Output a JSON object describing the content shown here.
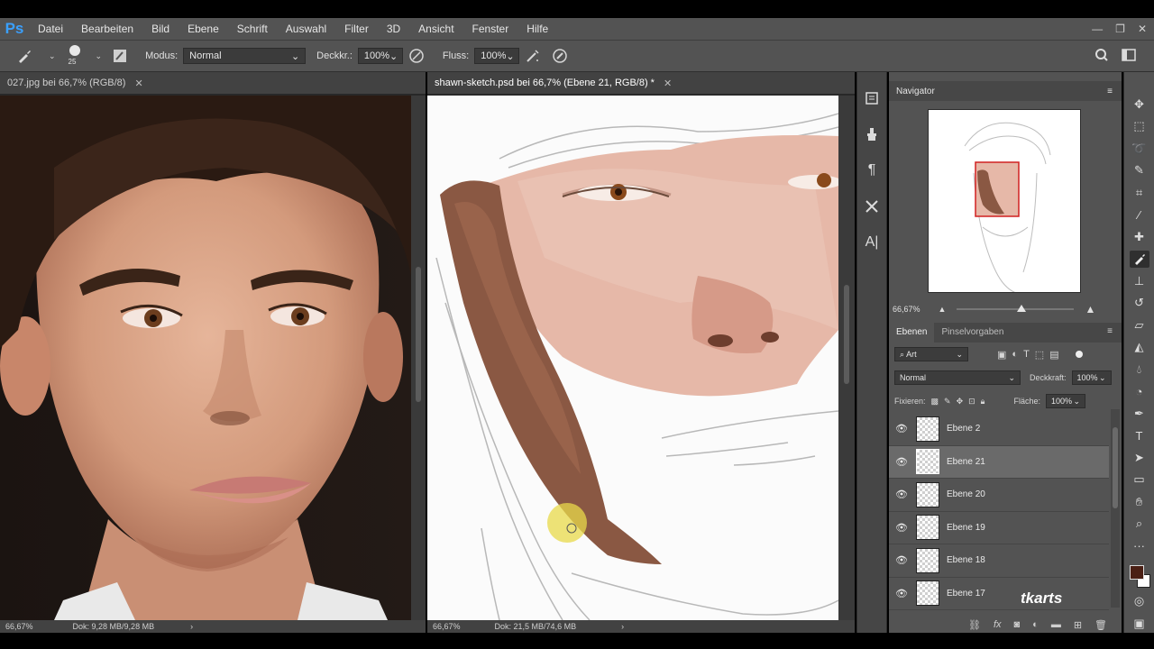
{
  "app": {
    "logo": "Ps",
    "menu": [
      "Datei",
      "Bearbeiten",
      "Bild",
      "Ebene",
      "Schrift",
      "Auswahl",
      "Filter",
      "3D",
      "Ansicht",
      "Fenster",
      "Hilfe"
    ],
    "window_controls": [
      "minimize-icon",
      "restore-icon",
      "close-icon"
    ]
  },
  "options": {
    "brush_size": "25",
    "mode_label": "Modus:",
    "mode_value": "Normal",
    "opacity_label": "Deckkr.:",
    "opacity_value": "100%",
    "flow_label": "Fluss:",
    "flow_value": "100%"
  },
  "doc1": {
    "tab_title": "027.jpg bei 66,7% (RGB/8)",
    "zoom": "66,67%",
    "doc_size": "Dok: 9,28 MB/9,28 MB"
  },
  "doc2": {
    "tab_title": "shawn-sketch.psd bei 66,7% (Ebene 21, RGB/8) *",
    "zoom": "66,67%",
    "doc_size": "Dok: 21,5 MB/74,6 MB"
  },
  "navigator": {
    "title": "Navigator",
    "zoom": "66,67%",
    "zoom_slider_fraction": 0.55
  },
  "layers": {
    "tabs": [
      "Ebenen",
      "Pinselvorgaben"
    ],
    "filter_kind": "Art",
    "blend_mode": "Normal",
    "opacity_label": "Deckkraft:",
    "opacity_value": "100%",
    "lock_label": "Fixieren:",
    "fill_label": "Fläche:",
    "fill_value": "100%",
    "items": [
      {
        "name": "Ebene 2",
        "selected": false
      },
      {
        "name": "Ebene 21",
        "selected": true
      },
      {
        "name": "Ebene 20",
        "selected": false
      },
      {
        "name": "Ebene 19",
        "selected": false
      },
      {
        "name": "Ebene 18",
        "selected": false
      },
      {
        "name": "Ebene 17",
        "selected": false
      }
    ]
  },
  "watermark": "tkarts",
  "colors": {
    "foreground": "#4a1f14",
    "background": "#ffffff",
    "ui_dark": "#535353",
    "skin_brown": "#8a5a45",
    "skin_pink": "#e2b3a3"
  }
}
